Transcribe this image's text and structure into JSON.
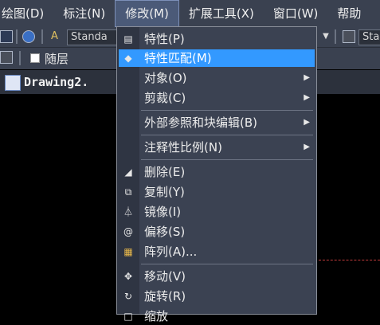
{
  "menubar": {
    "items": [
      {
        "label": "绘图(D)"
      },
      {
        "label": "标注(N)"
      },
      {
        "label": "修改(M)"
      },
      {
        "label": "扩展工具(X)"
      },
      {
        "label": "窗口(W)"
      },
      {
        "label": "帮助"
      }
    ]
  },
  "toolbar": {
    "text_style": "Standa",
    "dim_style": "Sta",
    "layer_color": "随层"
  },
  "tabs": {
    "document": "Drawing2."
  },
  "menu": {
    "items": [
      {
        "label": "特性(P)",
        "icon": "properties-icon"
      },
      {
        "label": "特性匹配(M)",
        "icon": "match-properties-icon",
        "highlighted": true
      },
      {
        "label": "对象(O)",
        "submenu": true
      },
      {
        "label": "剪裁(C)",
        "submenu": true
      },
      {
        "label": "外部参照和块编辑(B)",
        "submenu": true
      },
      {
        "label": "注释性比例(N)",
        "submenu": true
      },
      {
        "label": "删除(E)",
        "icon": "eraser-icon"
      },
      {
        "label": "复制(Y)",
        "icon": "copy-icon"
      },
      {
        "label": "镜像(I)",
        "icon": "mirror-icon"
      },
      {
        "label": "偏移(S)",
        "icon": "offset-icon"
      },
      {
        "label": "阵列(A)...",
        "icon": "array-icon"
      },
      {
        "label": "移动(V)",
        "icon": "move-icon"
      },
      {
        "label": "旋转(R)",
        "icon": "rotate-icon"
      },
      {
        "label": "缩放",
        "icon": "scale-icon"
      }
    ]
  },
  "colors": {
    "menubar_bg": "#3a4150",
    "menu_bg": "#3b4252",
    "highlight": "#3399ff"
  }
}
